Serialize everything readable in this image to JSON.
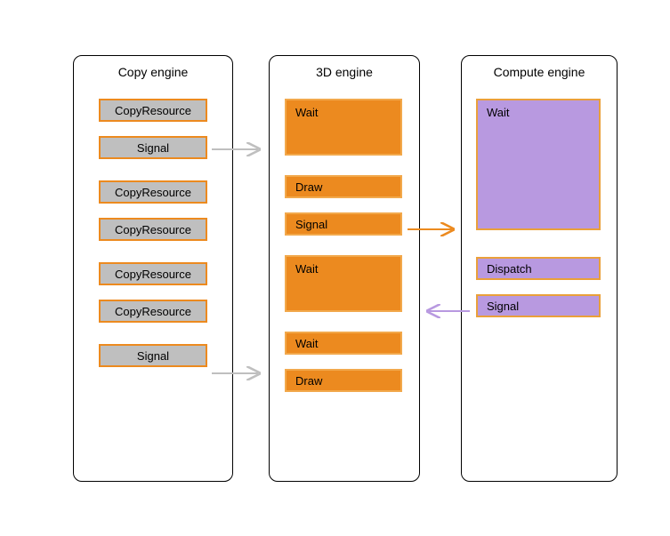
{
  "engines": {
    "copy": {
      "title": "Copy engine",
      "blocks": [
        {
          "label": "CopyResource"
        },
        {
          "label": "Signal"
        },
        {
          "label": "CopyResource"
        },
        {
          "label": "CopyResource"
        },
        {
          "label": "CopyResource"
        },
        {
          "label": "CopyResource"
        },
        {
          "label": "Signal"
        }
      ]
    },
    "d3": {
      "title": "3D engine",
      "blocks": [
        {
          "label": "Wait"
        },
        {
          "label": "Draw"
        },
        {
          "label": "Signal"
        },
        {
          "label": "Wait"
        },
        {
          "label": "Wait"
        },
        {
          "label": "Draw"
        }
      ]
    },
    "compute": {
      "title": "Compute engine",
      "blocks": [
        {
          "label": "Wait"
        },
        {
          "label": "Dispatch"
        },
        {
          "label": "Signal"
        }
      ]
    }
  },
  "arrows": [
    {
      "from": "copy.signal.1",
      "to": "d3.wait.1",
      "color": "#bfbfbf"
    },
    {
      "from": "copy.signal.2",
      "to": "d3.wait.2",
      "color": "#bfbfbf"
    },
    {
      "from": "d3.signal",
      "to": "compute.wait",
      "color": "#ec8a1f"
    },
    {
      "from": "compute.signal",
      "to": "d3.wait.2",
      "color": "#b899e0"
    }
  ],
  "colors": {
    "copy_fill": "#bfbfbf",
    "copy_border": "#ec8a1f",
    "d3_fill": "#ec8a1f",
    "d3_shadow": "#201a72",
    "compute_fill": "#b899e0",
    "arrow_gray": "#bfbfbf",
    "arrow_orange": "#ec8a1f",
    "arrow_purple": "#b899e0"
  }
}
